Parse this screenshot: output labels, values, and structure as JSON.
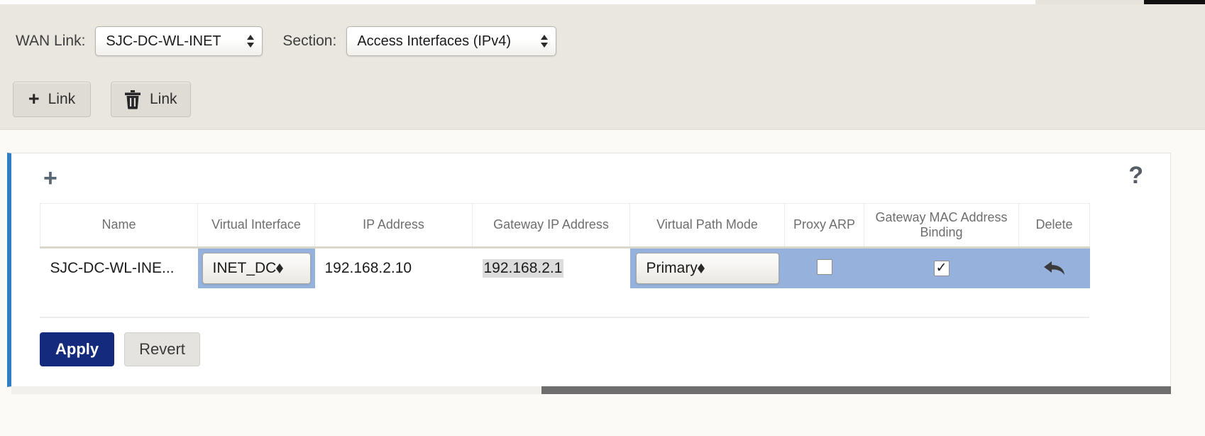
{
  "header": {
    "wan_link_label": "WAN Link:",
    "wan_link_value": "SJC-DC-WL-INET",
    "section_label": "Section:",
    "section_value": "Access Interfaces (IPv4)"
  },
  "toolbar": {
    "add_link_label": "Link",
    "add_link_icon": "plus-icon",
    "delete_link_label": "Link",
    "delete_link_icon": "trash-icon"
  },
  "panel": {
    "add_row_icon": "plus-icon",
    "help_icon": "question-mark-icon",
    "accent_color": "#2e7fc1"
  },
  "table": {
    "columns": [
      "Name",
      "Virtual Interface",
      "IP Address",
      "Gateway IP Address",
      "Virtual Path Mode",
      "Proxy ARP",
      "Gateway MAC Address Binding",
      "Delete"
    ],
    "rows": [
      {
        "name": "SJC-DC-WL-INE...",
        "virtual_interface": "INET_DC",
        "ip_address": "192.168.2.10",
        "gateway_ip_address": "192.168.2.1",
        "virtual_path_mode": "Primary",
        "proxy_arp": false,
        "gateway_mac_address_binding": true,
        "delete_icon": "undo-arrow-icon",
        "selected": true
      }
    ],
    "row_highlight_color": "#96b2dc"
  },
  "actions": {
    "apply_label": "Apply",
    "revert_label": "Revert",
    "apply_color": "#142a7c"
  },
  "scrollbar": {
    "orientation": "horizontal",
    "thumb_color": "#6e6e6e"
  }
}
